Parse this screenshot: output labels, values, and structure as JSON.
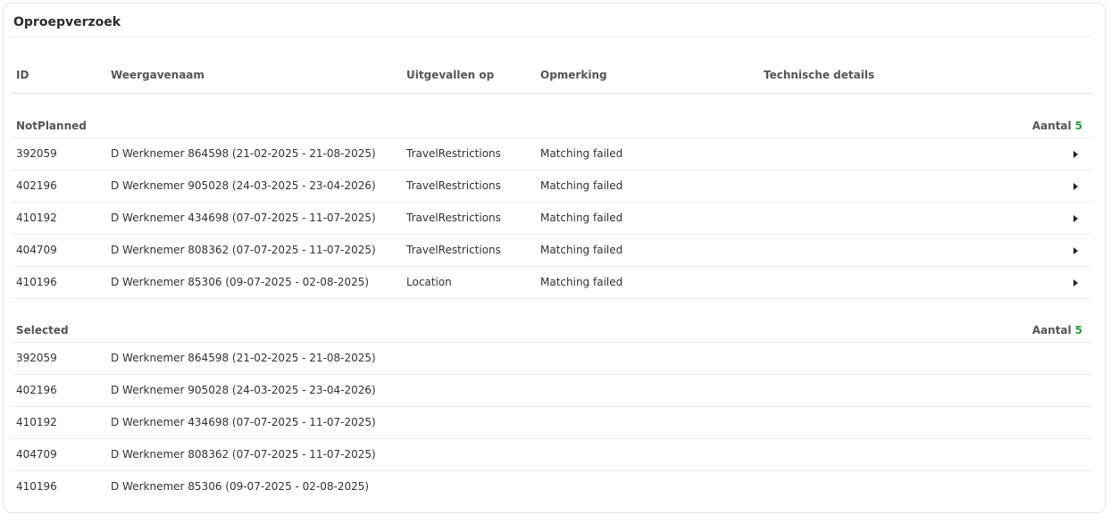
{
  "title": "Oproepverzoek",
  "columns": {
    "id": "ID",
    "name": "Weergavenaam",
    "reason": "Uitgevallen op",
    "remark": "Opmerking",
    "tech": "Technische details"
  },
  "groups": [
    {
      "name": "NotPlanned",
      "count_label": "Aantal",
      "count": "5",
      "rows": [
        {
          "id": "392059",
          "name": "D Werknemer 864598 (21-02-2025 - 21-08-2025)",
          "reason": "TravelRestrictions",
          "remark": "Matching failed",
          "expand_icon": "caret-right-icon"
        },
        {
          "id": "402196",
          "name": "D Werknemer 905028 (24-03-2025 - 23-04-2026)",
          "reason": "TravelRestrictions",
          "remark": "Matching failed",
          "expand_icon": "caret-right-icon"
        },
        {
          "id": "410192",
          "name": "D Werknemer 434698 (07-07-2025 - 11-07-2025)",
          "reason": "TravelRestrictions",
          "remark": "Matching failed",
          "expand_icon": "caret-right-icon"
        },
        {
          "id": "404709",
          "name": "D Werknemer 808362 (07-07-2025 - 11-07-2025)",
          "reason": "TravelRestrictions",
          "remark": "Matching failed",
          "expand_icon": "caret-right-icon"
        },
        {
          "id": "410196",
          "name": "D Werknemer 85306 (09-07-2025 - 02-08-2025)",
          "reason": "Location",
          "remark": "Matching failed",
          "expand_icon": "caret-right-icon"
        }
      ]
    },
    {
      "name": "Selected",
      "count_label": "Aantal",
      "count": "5",
      "rows": [
        {
          "id": "392059",
          "name": "D Werknemer 864598 (21-02-2025 - 21-08-2025)"
        },
        {
          "id": "402196",
          "name": "D Werknemer 905028 (24-03-2025 - 23-04-2026)"
        },
        {
          "id": "410192",
          "name": "D Werknemer 434698 (07-07-2025 - 11-07-2025)"
        },
        {
          "id": "404709",
          "name": "D Werknemer 808362 (07-07-2025 - 11-07-2025)"
        },
        {
          "id": "410196",
          "name": "D Werknemer 85306 (09-07-2025 - 02-08-2025)"
        }
      ]
    }
  ],
  "colors": {
    "count_accent": "#2e9e3e",
    "border": "#e3e3e3"
  }
}
